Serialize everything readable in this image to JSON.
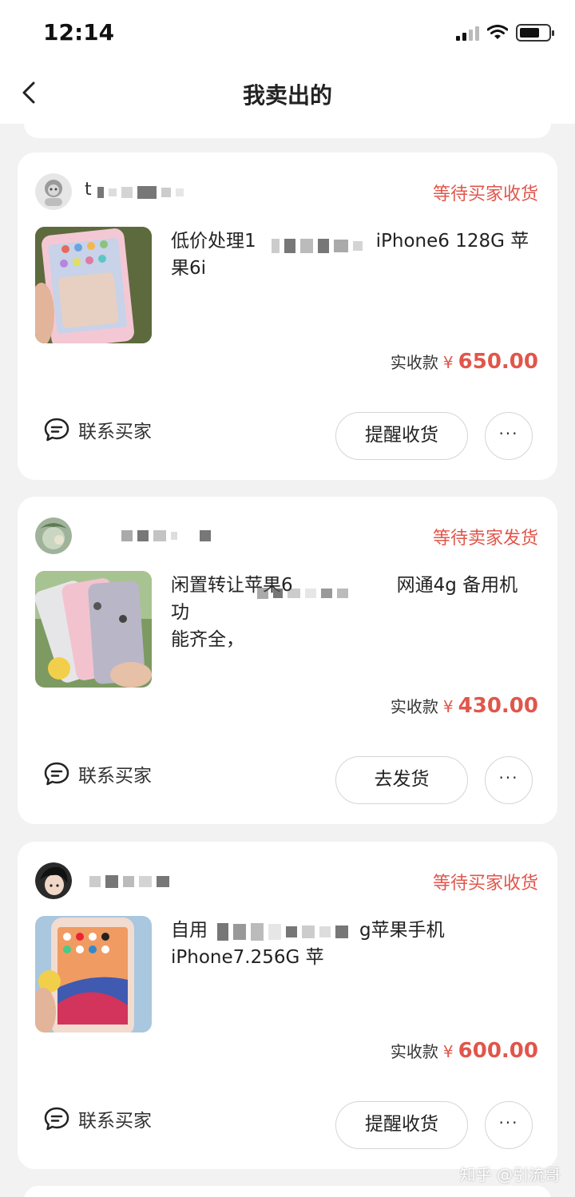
{
  "status_bar": {
    "time": "12:14"
  },
  "nav": {
    "title": "我卖出的"
  },
  "orders": [
    {
      "buyer_name": "t",
      "status": "等待买家收货",
      "title": "低价处理12…iPhone6 128G 苹果6i",
      "title_line1_a": "低价处理1",
      "title_line1_b": "iPhone6 128G 苹",
      "title_line2": "果6i",
      "price_label": "实收款",
      "currency": "¥",
      "price": "650.00",
      "contact_label": "联系买家",
      "action_label": "提醒收货",
      "more_label": "···"
    },
    {
      "buyer_name": "",
      "status": "等待卖家发货",
      "title_line1_a": "闲置转让苹果6",
      "title_line1_b": "网通4g 备用机 功",
      "title_line2": "能齐全，",
      "price_label": "实收款",
      "currency": "¥",
      "price": "430.00",
      "contact_label": "联系买家",
      "action_label": "去发货",
      "more_label": "···"
    },
    {
      "buyer_name": "",
      "status": "等待买家收货",
      "title_line1_a": "自用",
      "title_line1_b": "g苹果手机",
      "title_line2": "iPhone7.256G 苹",
      "price_label": "实收款",
      "currency": "¥",
      "price": "600.00",
      "contact_label": "联系买家",
      "action_label": "提醒收货",
      "more_label": "···"
    }
  ],
  "watermark": "知乎 @引流哥",
  "colors": {
    "accent": "#e0564b",
    "background": "#f2f2f2"
  },
  "icons": [
    "back-arrow-icon",
    "chat-bubble-icon",
    "signal-icon",
    "wifi-icon",
    "battery-icon"
  ]
}
